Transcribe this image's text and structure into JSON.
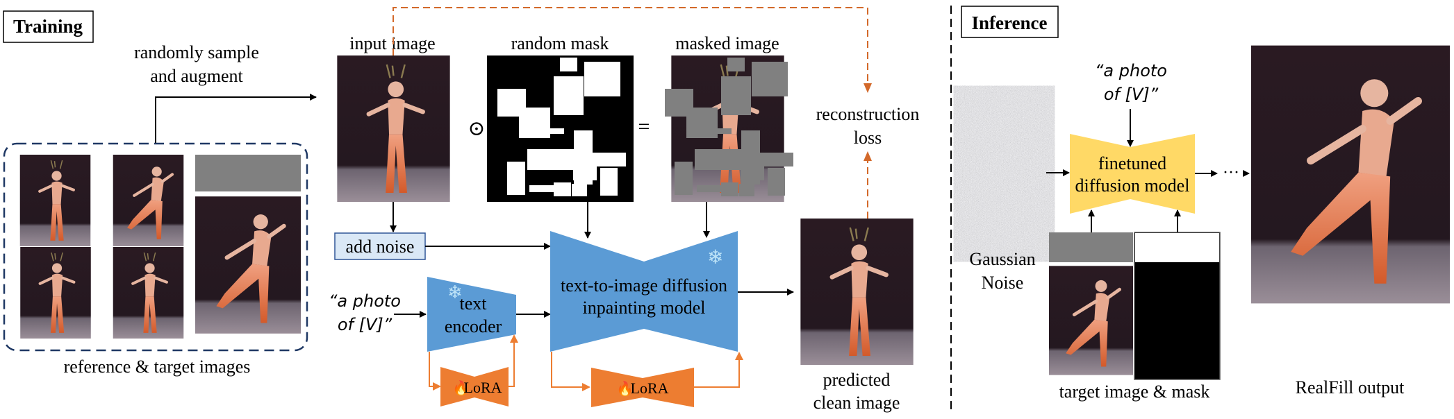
{
  "training": {
    "section_label": "Training",
    "sample_caption_line1": "randomly sample",
    "sample_caption_line2": "and augment",
    "reference_caption": "reference & target images",
    "input_image_label": "input image",
    "random_mask_label": "random mask",
    "masked_image_label": "masked image",
    "hadamard_symbol": "⊙",
    "equals_symbol": "=",
    "loss_line1": "reconstruction",
    "loss_line2": "loss",
    "add_noise_label": "add noise",
    "prompt_line1": "“a photo",
    "prompt_line2": "of [V]”",
    "text_encoder_line1": "text",
    "text_encoder_line2": "encoder",
    "diffusion_line1": "text-to-image diffusion",
    "diffusion_line2": "inpainting model",
    "lora_label": "LoRA",
    "predicted_line1": "predicted",
    "predicted_line2": "clean image",
    "frozen_icon": "snowflake-icon",
    "trainable_icon": "fire-icon"
  },
  "inference": {
    "section_label": "Inference",
    "prompt_line1": "“a photo",
    "prompt_line2": "of [V]”",
    "noise_line1": "Gaussian",
    "noise_line2": "Noise",
    "model_line1": "finetuned",
    "model_line2": "diffusion model",
    "ellipsis": "···",
    "target_caption": "target image & mask",
    "output_caption": "RealFill output"
  },
  "colors": {
    "blue_model": "#5b9bd5",
    "orange_lora": "#ed7d31",
    "orange_dashed": "#d3692a",
    "yellow_model": "#ffd966",
    "navy_dashed": "#1f3864",
    "noise_box_fill": "#dae8f6",
    "noise_box_stroke": "#2f5597",
    "snowflake": "#bde3f7",
    "mask_gray": "#808080"
  }
}
